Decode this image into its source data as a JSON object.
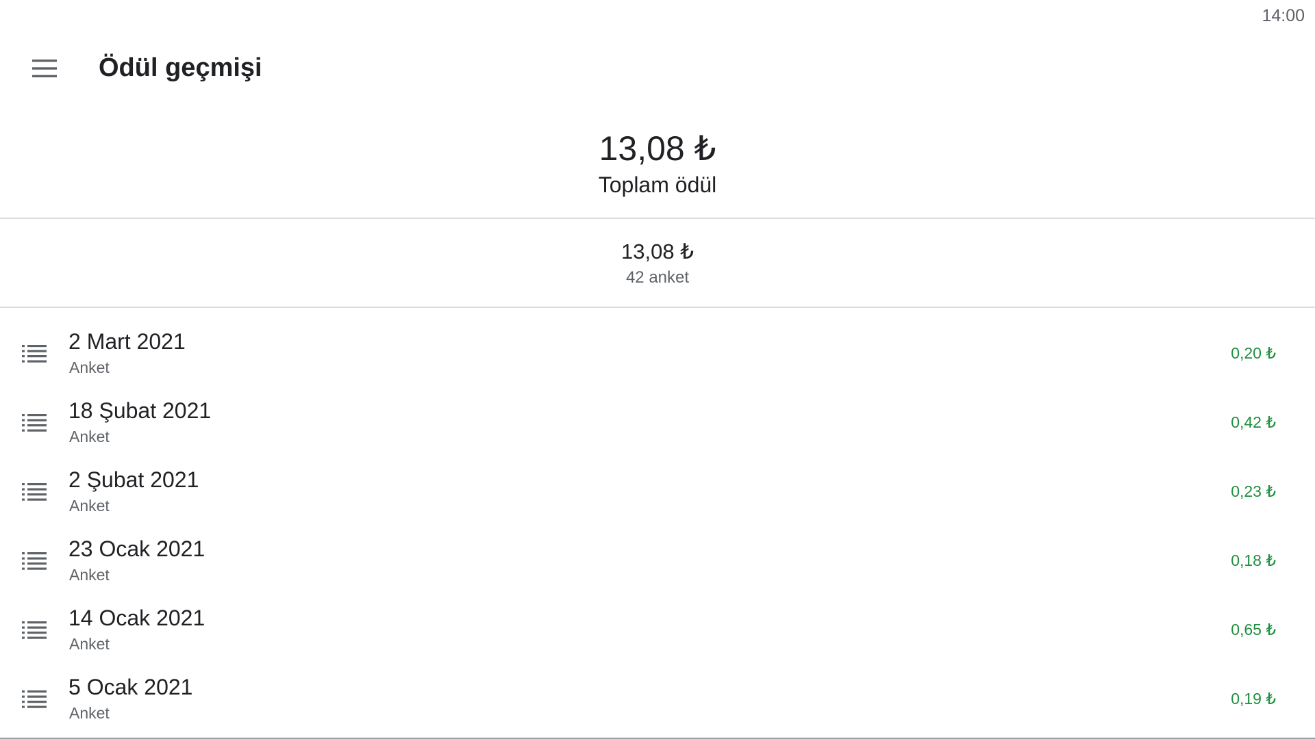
{
  "status_bar": {
    "time": "14:00"
  },
  "app_bar": {
    "menu_icon": "hamburger-menu-icon",
    "title": "Ödül geçmişi"
  },
  "total": {
    "amount": "13,08 ₺",
    "label": "Toplam ödül"
  },
  "summary": {
    "amount": "13,08 ₺",
    "count": "42 anket"
  },
  "rewards": [
    {
      "icon": "list-icon",
      "date": "2 Mart 2021",
      "type": "Anket",
      "amount": "0,20 ₺"
    },
    {
      "icon": "list-icon",
      "date": "18 Şubat 2021",
      "type": "Anket",
      "amount": "0,42 ₺"
    },
    {
      "icon": "list-icon",
      "date": "2 Şubat 2021",
      "type": "Anket",
      "amount": "0,23 ₺"
    },
    {
      "icon": "list-icon",
      "date": "23 Ocak 2021",
      "type": "Anket",
      "amount": "0,18 ₺"
    },
    {
      "icon": "list-icon",
      "date": "14 Ocak 2021",
      "type": "Anket",
      "amount": "0,65 ₺"
    },
    {
      "icon": "list-icon",
      "date": "5 Ocak 2021",
      "type": "Anket",
      "amount": "0,19 ₺"
    }
  ],
  "colors": {
    "amount_positive": "#1e8e3e",
    "divider": "#dadce0",
    "icon": "#5f6368"
  }
}
